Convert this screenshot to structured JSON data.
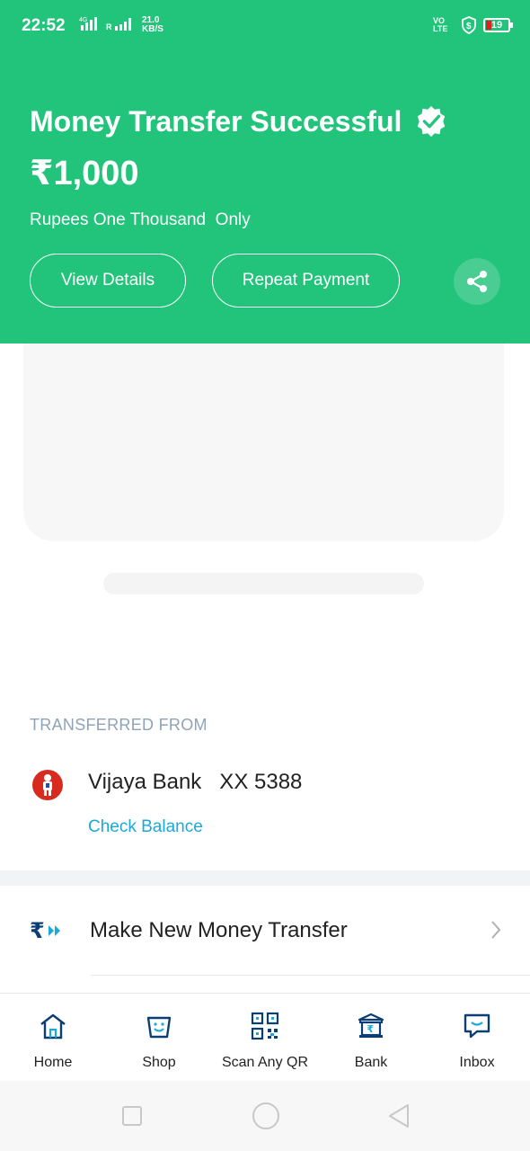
{
  "status_bar": {
    "time": "22:52",
    "net_4g": "4G",
    "roaming": "R",
    "speed_value": "21.0",
    "speed_unit": "KB/S",
    "volte": "VO LTE",
    "battery": "19"
  },
  "header": {
    "title": "Money Transfer Successful",
    "amount": "₹1,000",
    "amount_words": "Rupees One Thousand  Only",
    "view_details_label": "View Details",
    "repeat_payment_label": "Repeat Payment"
  },
  "transferred_from": {
    "section_label": "TRANSFERRED FROM",
    "bank_name": "Vijaya Bank   XX 5388",
    "check_balance_label": "Check Balance"
  },
  "actions": {
    "make_new_transfer_label": "Make New Money Transfer"
  },
  "bottom_nav": [
    {
      "label": "Home",
      "icon": "home-icon"
    },
    {
      "label": "Shop",
      "icon": "shop-bag-icon"
    },
    {
      "label": "Scan Any QR",
      "icon": "qr-icon"
    },
    {
      "label": "Bank",
      "icon": "bank-icon"
    },
    {
      "label": "Inbox",
      "icon": "inbox-chat-icon"
    }
  ],
  "colors": {
    "brand_green": "#22c37a",
    "link_blue": "#1aa9d8",
    "navy": "#0b3f73",
    "muted_label": "#8fa3b8"
  }
}
